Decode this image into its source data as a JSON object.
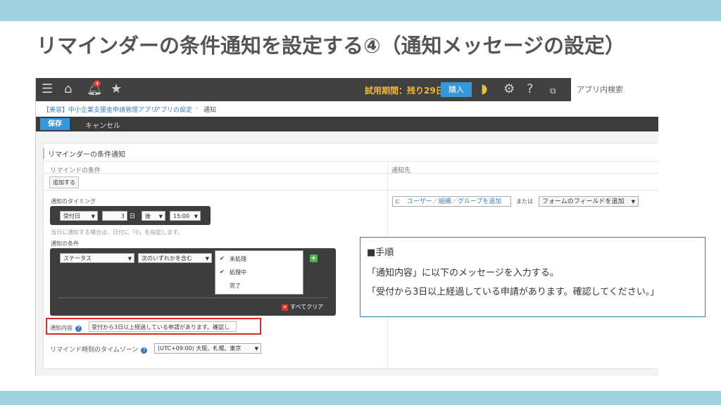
{
  "slide": {
    "title": "リマインダーの条件通知を設定する④（通知メッセージの設定）"
  },
  "topbar": {
    "icons": [
      "menu-icon",
      "home-icon",
      "bell-icon",
      "star-icon",
      "beginner-icon",
      "gear-icon",
      "help-icon",
      "plugin-icon"
    ],
    "bell_badge": "4",
    "trial_text": "試用期間：残り29日",
    "buy_label": "購入",
    "app_search_placeholder": "アプリ内検索"
  },
  "breadcrumb": {
    "items": [
      "【美容】中小企業支援金申請管理アプリ",
      "アプリの設定",
      "通知"
    ]
  },
  "actionbar": {
    "save_label": "保存",
    "cancel_label": "キャンセル"
  },
  "form": {
    "section_title": "リマインダーの条件通知",
    "remind_condition_header": "リマインドの条件",
    "notify_to_header": "通知先",
    "add_button": "追加する",
    "timing_label": "通知のタイミング",
    "timing": {
      "field": "受付日",
      "days": "3",
      "unit": "日",
      "direction": "後",
      "time": "15:00"
    },
    "timing_hint": "当日に通知する場合は、日付に「0」を指定します。",
    "condition_label": "通知の条件",
    "condition": {
      "field": "ステータス",
      "operator": "次のいずれかを含む",
      "options": [
        {
          "label": "未処理",
          "checked": true
        },
        {
          "label": "処理中",
          "checked": true
        },
        {
          "label": "完了",
          "checked": false
        }
      ],
      "clear_all": "すべてクリア"
    },
    "message_label": "通知内容",
    "message_value": "受付から3日以上経過している申請があります。確認し",
    "timezone_label": "リマインド時刻のタイムゾーン",
    "timezone_value": "(UTC+09:00) 大阪、札幌、東京",
    "notify_input_placeholder": "ユーザー／組織／グループを追加",
    "or_text": "または",
    "field_select": "フォームのフィールドを追加"
  },
  "callout": {
    "heading": "■手順",
    "line1": "「通知内容」に以下のメッセージを入力する。",
    "line2": "「受付から3日以上経過している申請があります。確認してください。」"
  },
  "colors": {
    "band": "#9fd3e2",
    "topbar": "#404040",
    "accent_blue": "#3498db",
    "highlight_red": "#d92b2b",
    "trial_orange": "#f2b63a"
  }
}
